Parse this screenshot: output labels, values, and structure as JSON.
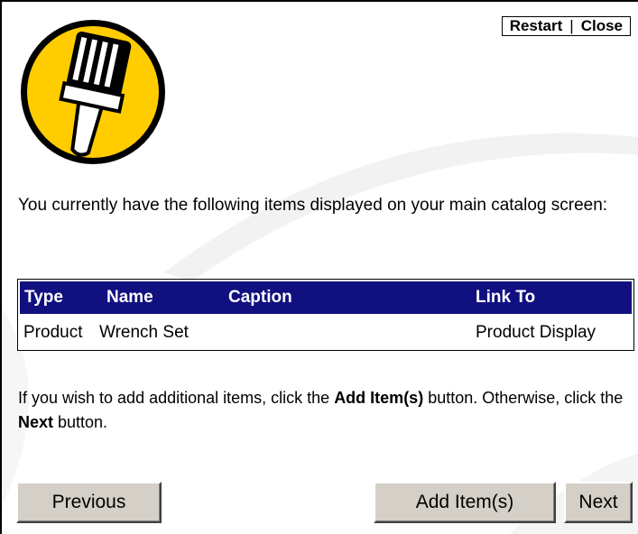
{
  "header": {
    "restart_label": "Restart",
    "separator": "|",
    "close_label": "Close"
  },
  "logo": {
    "icon": "paintbrush-icon",
    "color": "#FFCC00"
  },
  "intro_text": "You currently have the following items displayed on your main catalog screen:",
  "table": {
    "header_color": "#101080",
    "columns": [
      "Type",
      "Name",
      "Caption",
      "Link To"
    ],
    "rows": [
      {
        "type": "Product",
        "name": "Wrench Set",
        "caption": "",
        "link_to": "Product Display"
      }
    ]
  },
  "instructions": {
    "part1": "If you wish to add additional items, click the ",
    "bold1": "Add Item(s)",
    "part2": " button. Otherwise, click the ",
    "bold2": "Next",
    "part3": " button."
  },
  "buttons": {
    "previous": "Previous",
    "add_items": "Add Item(s)",
    "next": "Next"
  }
}
